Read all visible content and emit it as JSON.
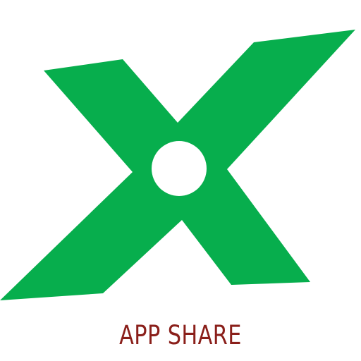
{
  "logo": {
    "icon": "x-logo-icon",
    "mark_color": "#07AE4D",
    "center_color": "#FFFFFF"
  },
  "brand": {
    "label": "APP SHARE",
    "label_color": "#8A1F1A"
  }
}
